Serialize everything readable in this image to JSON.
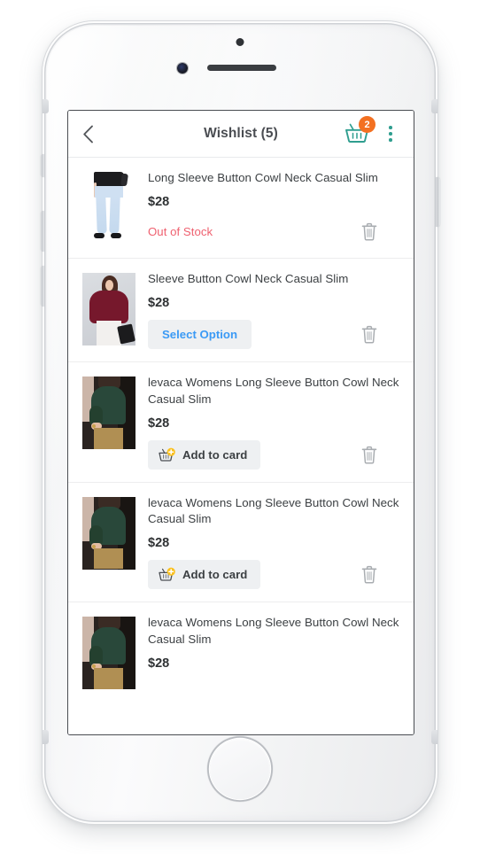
{
  "device": {
    "frame": "iphone-white-silver",
    "hardware": {
      "sensor": "proximity-sensor",
      "camera": "front-camera",
      "speaker": "earpiece-speaker",
      "home": "home-button"
    }
  },
  "header": {
    "back_icon": "chevron-left-icon",
    "title": "Wishlist (5)",
    "cart_icon": "shopping-basket-icon",
    "cart_badge": "2",
    "menu_icon": "kebab-menu-icon",
    "accent_teal": "#2f9e8f",
    "badge_orange": "#f37021"
  },
  "colors": {
    "out_of_stock": "#ef6170",
    "select_option_text": "#3b9af5",
    "button_bg": "#eef0f2",
    "title_text": "#3c4043",
    "price_text": "#2e3133",
    "divider": "#ededee"
  },
  "list": {
    "items": [
      {
        "title": "Long Sleeve Button Cowl Neck Casual Slim",
        "price": "$28",
        "action_type": "status",
        "action_label": "Out of Stock",
        "thumb": "light-blue-skinny-jeans-photo",
        "delete_icon": "trash-icon"
      },
      {
        "title": "Sleeve Button Cowl Neck Casual Slim",
        "price": "$28",
        "action_type": "select",
        "action_label": "Select Option",
        "thumb": "maroon-top-white-pants-photo",
        "delete_icon": "trash-icon"
      },
      {
        "title": "levaca Womens Long Sleeve Button Cowl Neck Casual Slim",
        "price": "$28",
        "action_type": "add",
        "action_label": "Add to card",
        "action_icon": "basket-plus-icon",
        "thumb": "green-sweater-khaki-pants-photo",
        "delete_icon": "trash-icon"
      },
      {
        "title": "levaca Womens Long Sleeve Button Cowl Neck Casual Slim",
        "price": "$28",
        "action_type": "add",
        "action_label": "Add to card",
        "action_icon": "basket-plus-icon",
        "thumb": "green-sweater-khaki-pants-photo",
        "delete_icon": "trash-icon"
      },
      {
        "title": "levaca Womens Long Sleeve Button Cowl Neck Casual Slim",
        "price": "$28",
        "action_type": "none",
        "action_label": "",
        "thumb": "green-sweater-khaki-pants-photo",
        "delete_icon": "trash-icon"
      }
    ]
  }
}
